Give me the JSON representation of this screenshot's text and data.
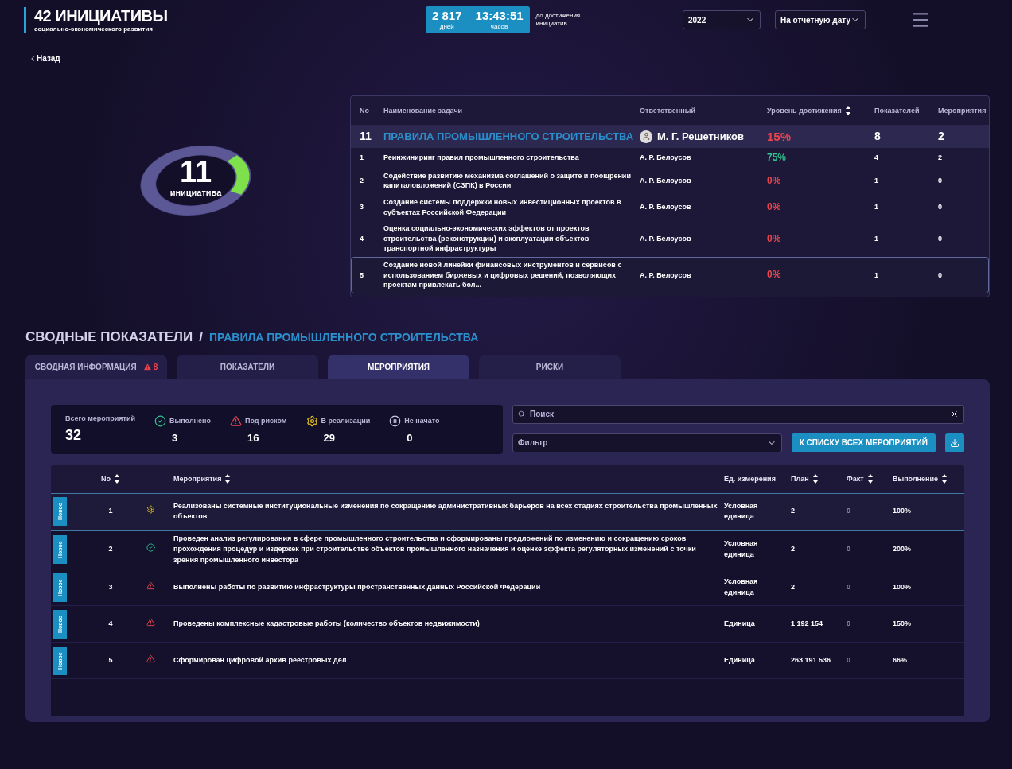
{
  "header": {
    "title": "42 ИНИЦИАТИВЫ",
    "subtitle": "социально-экономического развития",
    "counter": {
      "days": "2 817",
      "days_label": "дней",
      "time": "13:43:51",
      "time_label": "часов"
    },
    "counter_caption": "до достижения инициатив",
    "year_select": "2022",
    "date_select": "На отчетную дату"
  },
  "back_link": "Назад",
  "ring": {
    "number": "11",
    "label": "инициатива",
    "level": 0.2
  },
  "tasks": {
    "columns": [
      {
        "label": "No",
        "sortable": false
      },
      {
        "label": "Наименование задачи",
        "sortable": false
      },
      {
        "label": "Ответственный",
        "sortable": false
      },
      {
        "label": "Уровень достижения",
        "sortable": true
      },
      {
        "label": "Показателей",
        "sortable": false
      },
      {
        "label": "Мероприятия",
        "sortable": false
      }
    ],
    "initiative": {
      "number": "11",
      "name": "ПРАВИЛА ПРОМЫШЛЕННОГО СТРОИТЕЛЬСТВА",
      "owner": "М. Г. Решетников",
      "level": "15%",
      "color": "#e8454f",
      "indicators": "8",
      "events": "2"
    },
    "rows": [
      {
        "number": "1",
        "name": "Реинжиниринг правил промышленного строительства",
        "owner": "А. Р. Белоусов",
        "level": "75%",
        "color": "#2fc48e",
        "indicators": "4",
        "events": "2",
        "selected": false
      },
      {
        "number": "2",
        "name": "Содействие развитию механизма соглашений о защите и поощрении капиталовложений (СЗПК) в России",
        "owner": "А. Р. Белоусов",
        "level": "0%",
        "color": "#e8454f",
        "indicators": "1",
        "events": "0",
        "selected": false
      },
      {
        "number": "3",
        "name": "Создание системы поддержки новых инвестиционных проектов в субъектах Российской Федерации",
        "owner": "А. Р. Белоусов",
        "level": "0%",
        "color": "#e8454f",
        "indicators": "1",
        "events": "0",
        "selected": false
      },
      {
        "number": "4",
        "name": "Оценка социально-экономических эффектов от проектов строительства (реконструкции) и эксплуатации объектов транспортной инфраструктуры",
        "owner": "А. Р. Белоусов",
        "level": "0%",
        "color": "#e8454f",
        "indicators": "1",
        "events": "0",
        "selected": false
      },
      {
        "number": "5",
        "name": "Создание новой линейки финансовых инструментов и сервисов с использованием биржевых и цифровых решений, позволяющих проектам привлекать бол...",
        "owner": "А. Р. Белоусов",
        "level": "0%",
        "color": "#e8454f",
        "indicators": "1",
        "events": "0",
        "selected": true
      }
    ]
  },
  "section": {
    "title": "СВОДНЫЕ ПОКАЗАТЕЛИ",
    "separator": "/",
    "subtitle": "ПРАВИЛА ПРОМЫШЛЕННОГО СТРОИТЕЛЬСТВА"
  },
  "tabs": [
    {
      "label": "СВОДНАЯ ИНФОРМАЦИЯ",
      "badge": "8",
      "selected": false
    },
    {
      "label": "ПОКАЗАТЕЛИ",
      "selected": false
    },
    {
      "label": "МЕРОПРИЯТИЯ",
      "selected": true
    },
    {
      "label": "РИСКИ",
      "selected": false
    }
  ],
  "stats": [
    {
      "kind": "total",
      "label": "Всего мероприятий",
      "value": "32"
    },
    {
      "kind": "done",
      "label": "Выполнено",
      "value": "3"
    },
    {
      "kind": "risk",
      "label": "Под риском",
      "value": "16"
    },
    {
      "kind": "progress",
      "label": "В реализации",
      "value": "29"
    },
    {
      "kind": "not_started",
      "label": "Не начато",
      "value": "0"
    }
  ],
  "search": {
    "placeholder": "Поиск"
  },
  "filter": {
    "placeholder": "Фильтр"
  },
  "all_events_button": "К СПИСКУ ВСЕХ МЕРОПРИЯТИЙ",
  "events": {
    "columns": [
      {
        "label": "No",
        "sortable": true
      },
      {
        "label": "Мероприятия",
        "sortable": true
      },
      {
        "label": "Ед. измерения",
        "sortable": false
      },
      {
        "label": "План",
        "sortable": true
      },
      {
        "label": "Факт",
        "sortable": true
      },
      {
        "label": "Выполнение",
        "sortable": true
      }
    ],
    "rows": [
      {
        "tag": "Новое",
        "number": "1",
        "kind": "progress",
        "name": "Реализованы системные институциональные изменения по сокращению административных барьеров на всех стадиях строительства промышленных объектов",
        "unit": "Условная единица",
        "plan": "2",
        "fact": "0",
        "done": "100%",
        "selected": true
      },
      {
        "tag": "Новое",
        "number": "2",
        "kind": "done",
        "name": "Проведен анализ регулирования в сфере промышленного строительства и сформированы предложений по изменению и сокращению сроков прохождения процедур и издержек при строительстве объектов промышленного назначения и оценке эффекта регуляторных изменений с точки зрения промышленного инвестора",
        "unit": "Условная единица",
        "plan": "2",
        "fact": "0",
        "done": "200%",
        "selected": false
      },
      {
        "tag": "Новое",
        "number": "3",
        "kind": "risk",
        "name": "Выполнены работы по развитию инфраструктуры пространственных данных Российской Федерации",
        "unit": "Условная единица",
        "plan": "2",
        "fact": "0",
        "done": "100%",
        "selected": false
      },
      {
        "tag": "Новое",
        "number": "4",
        "kind": "risk",
        "name": "Проведены комплексные кадастровые работы (количество объектов недвижимости)",
        "unit": "Единица",
        "plan": "1 192 154",
        "fact": "0",
        "done": "150%",
        "selected": false
      },
      {
        "tag": "Новое",
        "number": "5",
        "kind": "risk",
        "name": "Сформирован цифровой архив реестровых дел",
        "unit": "Единица",
        "plan": "263 191 536",
        "fact": "0",
        "done": "66%",
        "selected": false
      }
    ]
  }
}
